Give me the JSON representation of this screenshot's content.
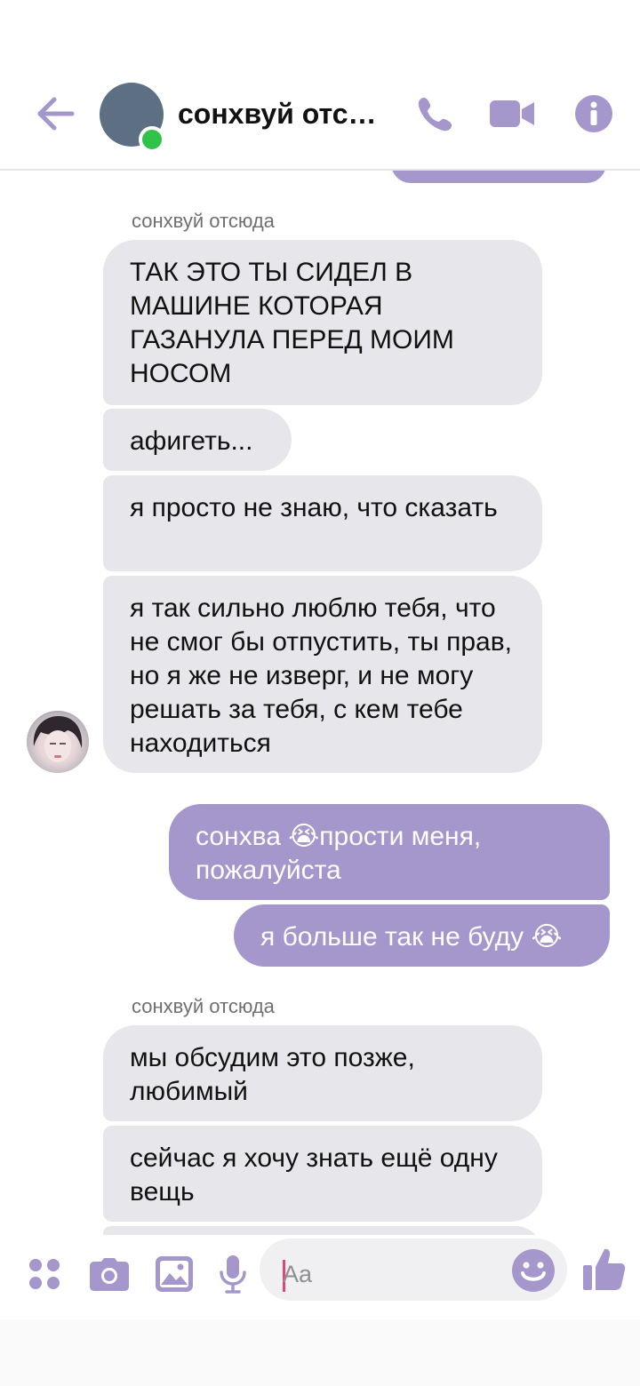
{
  "header": {
    "title": "сонхвуй отсюда",
    "back_icon": "back-arrow-icon",
    "call_icon": "phone-icon",
    "video_icon": "video-camera-icon",
    "info_icon": "info-icon",
    "status": "online",
    "accent_color": "#a597cc"
  },
  "messages": {
    "group1_sender": "сонхвуй отсюда",
    "m1": "ТАК ЭТО ТЫ СИДЕЛ В МАШИНЕ КОТОРАЯ ГАЗАНУЛА ПЕРЕД МОИМ НОСОМ",
    "m2": "афигеть...",
    "m3": "я просто не знаю, что сказать",
    "m4": "я так сильно люблю тебя, что не смог бы отпустить, ты прав, но я же не изверг, и не могу решать за тебя, с кем тебе находиться",
    "out1_a": "сонхва ",
    "out1_emoji": "😭",
    "out1_b": "прости меня, пожалуйста",
    "out2_text": "я больше так не буду ",
    "out2_emoji": "😭",
    "group2_sender": "сонхвуй отсюда",
    "m5": "мы обсудим это позже, любимый",
    "m6": "сейчас я хочу знать ещё одну вещь"
  },
  "composer": {
    "placeholder": "Aa",
    "icons": [
      "apps-grid-icon",
      "camera-icon",
      "gallery-icon",
      "microphone-icon",
      "emoji-icon",
      "thumbs-up-icon"
    ]
  }
}
